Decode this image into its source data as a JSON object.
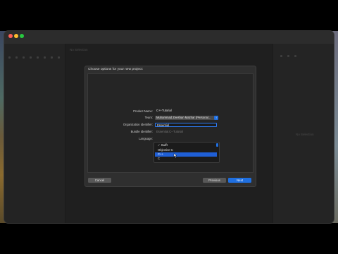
{
  "window": {
    "breadcrumb": "No Selection",
    "right_panel_text": "No Selection"
  },
  "sheet": {
    "title": "Choose options for your new project:",
    "fields": {
      "product_name_label": "Product Name:",
      "product_name_value": "C++Tutorial",
      "team_label": "Team:",
      "team_value": "Muhammad Zeeshan Mazhar (Personal...",
      "org_label": "Organization Identifier:",
      "org_value": "Essential",
      "bundle_label": "Bundle Identifier:",
      "bundle_value": "Essential.C--Tutorial",
      "language_label": "Language:"
    },
    "language_menu": {
      "items": [
        "✓ Swift",
        "Objective-C",
        "C++",
        "C"
      ],
      "selected": "C++"
    },
    "buttons": {
      "cancel": "Cancel",
      "previous": "Previous",
      "next": "Next"
    }
  },
  "colors": {
    "accent": "#1f6fe0",
    "sheet_bg": "#2f2f2f",
    "window_bg": "#262626"
  }
}
